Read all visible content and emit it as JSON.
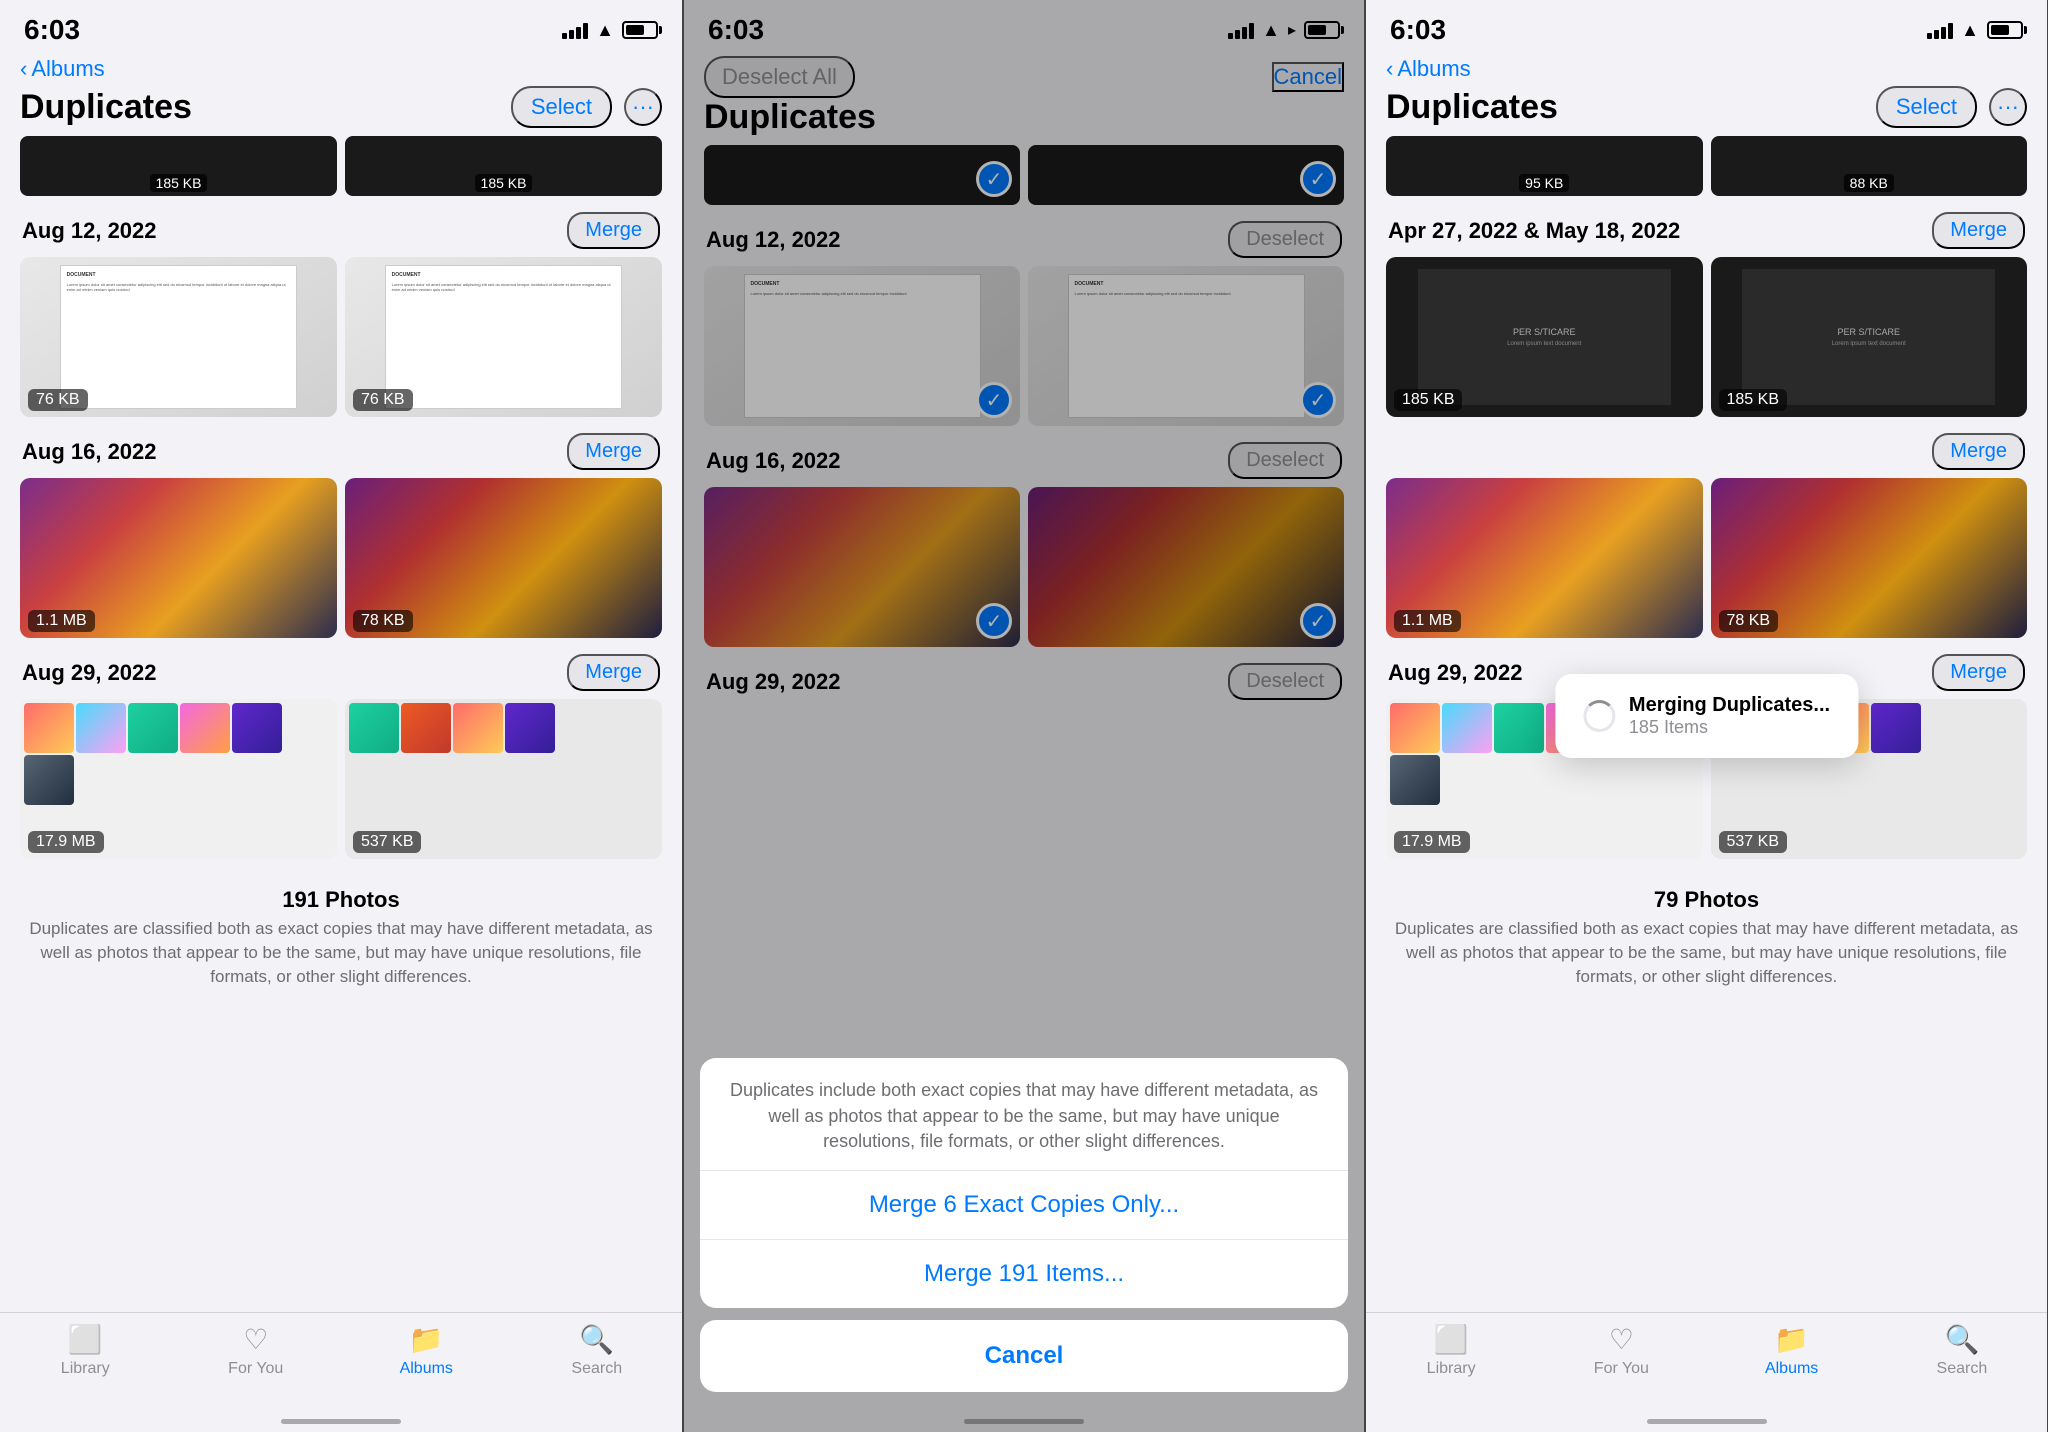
{
  "panels": {
    "left": {
      "time": "6:03",
      "back_label": "Albums",
      "page_title": "Duplicates",
      "select_label": "Select",
      "groups": [
        {
          "id": "group-top-strip",
          "sizes": [
            "185 KB",
            "185 KB"
          ]
        },
        {
          "id": "group-aug12",
          "date": "Aug 12, 2022",
          "merge_label": "Merge",
          "sizes": [
            "76 KB",
            "76 KB"
          ],
          "type": "doc"
        },
        {
          "id": "group-aug16",
          "date": "Aug 16, 2022",
          "merge_label": "Merge",
          "sizes": [
            "1.1 MB",
            "78 KB"
          ],
          "type": "purple"
        },
        {
          "id": "group-aug29",
          "date": "Aug 29, 2022",
          "merge_label": "Merge",
          "sizes": [
            "17.9 MB",
            "537 KB"
          ],
          "type": "strip"
        }
      ],
      "footer_count": "191 Photos",
      "footer_desc": "Duplicates are classified both as exact copies that may have different metadata, as well as photos that appear to be the same, but may have unique resolutions, file formats, or other slight differences.",
      "tabs": [
        {
          "id": "library",
          "label": "Library",
          "icon": "🖼",
          "active": false
        },
        {
          "id": "for-you",
          "label": "For You",
          "icon": "❤️",
          "active": false
        },
        {
          "id": "albums",
          "label": "Albums",
          "icon": "📁",
          "active": true
        },
        {
          "id": "search",
          "label": "Search",
          "icon": "🔍",
          "active": false
        }
      ]
    },
    "middle": {
      "time": "6:03",
      "deselect_all_label": "Deselect All",
      "cancel_label": "Cancel",
      "page_title": "Duplicates",
      "groups": [
        {
          "id": "group-top-strip",
          "sizes": [
            "",
            ""
          ],
          "checked": true
        },
        {
          "id": "group-aug12",
          "date": "Aug 12, 2022",
          "deselect_label": "Deselect",
          "sizes": [
            "",
            ""
          ],
          "type": "doc",
          "checked": true
        },
        {
          "id": "group-aug16",
          "date": "Aug 16, 2022",
          "deselect_label": "Deselect",
          "sizes": [
            "",
            ""
          ],
          "type": "purple",
          "checked": true
        },
        {
          "id": "group-aug29",
          "date": "Aug 29, 2022",
          "deselect_label": "Deselect",
          "sizes": [
            "",
            ""
          ],
          "type": "strip"
        }
      ],
      "action_sheet": {
        "description": "Duplicates include both exact copies that may have different metadata, as well as photos that appear to be the same, but may have unique resolutions, file formats, or other slight differences.",
        "merge_exact_label": "Merge 6 Exact Copies Only...",
        "merge_all_label": "Merge 191 Items...",
        "cancel_label": "Cancel"
      }
    },
    "right": {
      "time": "6:03",
      "back_label": "Albums",
      "page_title": "Duplicates",
      "select_label": "Select",
      "groups": [
        {
          "id": "group-top-strip",
          "sizes": [
            "95 KB",
            "88 KB"
          ]
        },
        {
          "id": "group-apr27",
          "date": "Apr 27, 2022 & May 18, 2022",
          "merge_label": "Merge",
          "sizes": [
            "185 KB",
            "185 KB"
          ],
          "type": "dark"
        },
        {
          "id": "group-merge2",
          "date": "",
          "merge_label": "Merge",
          "sizes": [
            "1.1 MB",
            "78 KB"
          ],
          "type": "purple"
        },
        {
          "id": "group-aug29r",
          "date": "Aug 29, 2022",
          "merge_label": "Merge",
          "sizes": [
            "17.9 MB",
            "537 KB"
          ],
          "type": "strip"
        }
      ],
      "footer_count": "79 Photos",
      "footer_desc": "Duplicates are classified both as exact copies that may have different metadata, as well as photos that appear to be the same, but may have unique resolutions, file formats, or other slight differences.",
      "toast": {
        "title": "Merging Duplicates...",
        "subtitle": "185 Items"
      },
      "tabs": [
        {
          "id": "library",
          "label": "Library",
          "icon": "🖼",
          "active": false
        },
        {
          "id": "for-you",
          "label": "For You",
          "icon": "❤️",
          "active": false
        },
        {
          "id": "albums",
          "label": "Albums",
          "icon": "📁",
          "active": true
        },
        {
          "id": "search",
          "label": "Search",
          "icon": "🔍",
          "active": false
        }
      ]
    }
  }
}
